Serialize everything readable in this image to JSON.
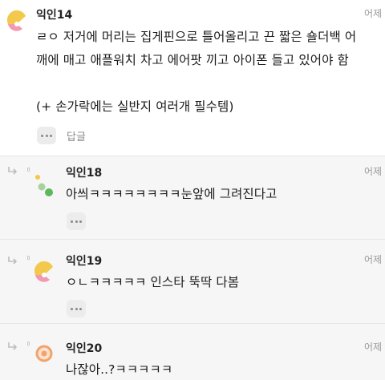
{
  "comments": [
    {
      "nickname": "익인14",
      "time": "어제",
      "text": "ㄹㅇ 저거에 머리는 집게핀으로 틀어올리고 끈 짧은 숄더백 어\n깨에 매고 애플워치 차고 에어팟 끼고 아이폰 들고 있어야 함\n\n(+ 손가락에는 실반지 여러개 필수템)",
      "reply_label": "답글",
      "avatar": {
        "icon": "avatar-yellow-pink-icon",
        "colors": [
          "#f2c94c",
          "#f29ab2"
        ]
      }
    }
  ],
  "replies": [
    {
      "nickname": "익인18",
      "time": "어제",
      "text": "아씌ㅋㅋㅋㅋㅋㅋㅋㅋ눈앞에 그려진다고",
      "avatar": {
        "icon": "avatar-green-dots-icon",
        "colors": [
          "#f5c64a",
          "#5db85c",
          "#a7d39a"
        ]
      }
    },
    {
      "nickname": "익인19",
      "time": "어제",
      "text": "ㅇㄴㅋㅋㅋㅋㅋ 인스타 뚝딱 다봄",
      "avatar": {
        "icon": "avatar-yellow-pink-icon",
        "colors": [
          "#f2c94c",
          "#f29ab2"
        ]
      }
    },
    {
      "nickname": "익인20",
      "time": "어제",
      "text": "나잖아..?ㅋㅋㅋㅋㅋ",
      "avatar": {
        "icon": "avatar-orange-ring-icon",
        "colors": [
          "#f1a36a",
          "#fbe1cf"
        ]
      }
    }
  ]
}
